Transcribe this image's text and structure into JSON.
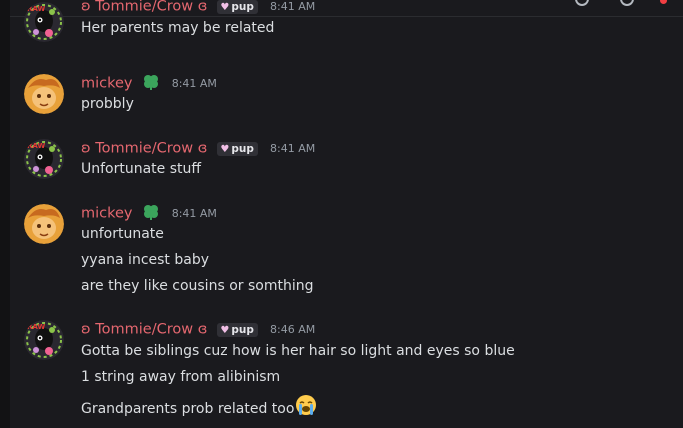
{
  "users": {
    "tommie": {
      "name": "ʚ Tommie/Crow ɞ",
      "tag": "pup",
      "tag_icon": "heart",
      "avatar_icon": "crow-avatar"
    },
    "mickey": {
      "name": "mickey",
      "badge_icon": "clover-icon",
      "avatar_icon": "fox-avatar"
    }
  },
  "colors": {
    "background": "#1a1a1e",
    "username": "#e4676f",
    "text": "#dbdee1",
    "timestamp": "#949ba4"
  },
  "messages": [
    {
      "user": "tommie",
      "time": "8:41 AM",
      "lines": [
        "Her parents may be related"
      ]
    },
    {
      "user": "mickey",
      "time": "8:41 AM",
      "lines": [
        "probbly"
      ]
    },
    {
      "user": "tommie",
      "time": "8:41 AM",
      "lines": [
        "Unfortunate stuff"
      ]
    },
    {
      "user": "mickey",
      "time": "8:41 AM",
      "lines": [
        "unfortunate",
        "yyana incest baby",
        "are they like cousins or somthing"
      ]
    },
    {
      "user": "tommie",
      "time": "8:46 AM",
      "lines": [
        "Gotta be siblings cuz how is her hair so light and eyes so blue",
        "1 string away from alibinism",
        "Grandparents prob related too"
      ],
      "trailing_emoji": "loudly-crying-face"
    }
  ]
}
